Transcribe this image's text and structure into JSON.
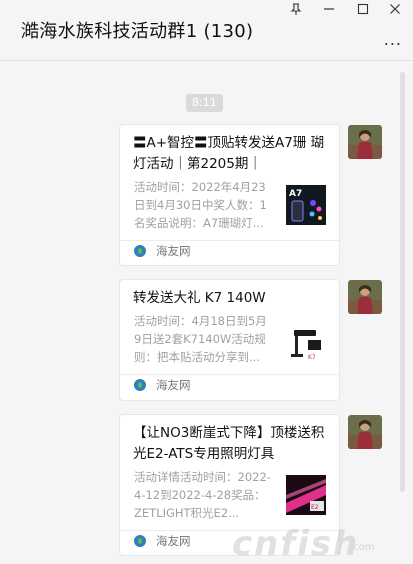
{
  "window": {
    "title": "澔海水族科技活动群1 (130)",
    "controls": [
      "pin-icon",
      "minimize-icon",
      "maximize-icon",
      "close-icon"
    ],
    "more": "..."
  },
  "chat": {
    "timestamp": "8:11",
    "messages": [
      {
        "title": "〓A+智控〓顶贴转发送A7珊 瑚灯活动｜第2205期｜",
        "desc": "活动时间：2022年4月23日到4月30日中奖人数：1名奖品说明：A7珊瑚灯...",
        "source": "海友网"
      },
      {
        "title": "转发送大礼 K7 140W",
        "desc": "活动时间：4月18日到5月9日送2套K7140W活动规则：把本贴活动分享到...",
        "source": "海友网"
      },
      {
        "title": "【让NO3断崖式下降】顶楼送积光E2-ATS专用照明灯具",
        "desc": "活动详情活动时间：2022-4-12到2022-4-28奖品：ZETLIGHT积光E2...",
        "source": "海友网"
      }
    ]
  },
  "watermark": {
    "main": "cnfish",
    "sub": ".com"
  }
}
